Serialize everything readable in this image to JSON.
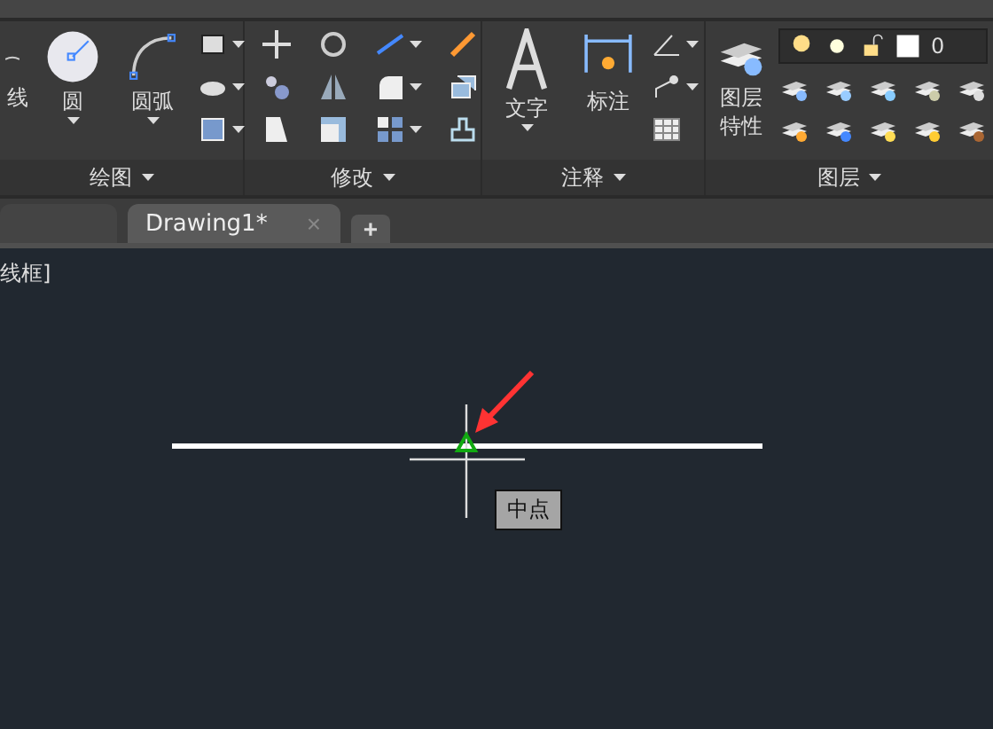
{
  "panels": [
    {
      "kind": "draw",
      "title": "绘图",
      "tools": [
        {
          "label": "线"
        },
        {
          "label": "圆"
        },
        {
          "label": "圆弧"
        }
      ]
    },
    {
      "kind": "modify",
      "title": "修改"
    },
    {
      "kind": "annotate",
      "title": "注释",
      "tools": [
        {
          "label": "文字"
        },
        {
          "label": "标注"
        }
      ]
    },
    {
      "kind": "layers",
      "title": "图层",
      "tools": [
        {
          "label": "图层特性"
        }
      ],
      "layer": "0"
    }
  ],
  "file_tabs": [
    {
      "label": "Drawing1*",
      "selected": true,
      "close": "×"
    }
  ],
  "new_tab": "+",
  "viewport_label": "线框]",
  "snap_tooltip": "中点"
}
